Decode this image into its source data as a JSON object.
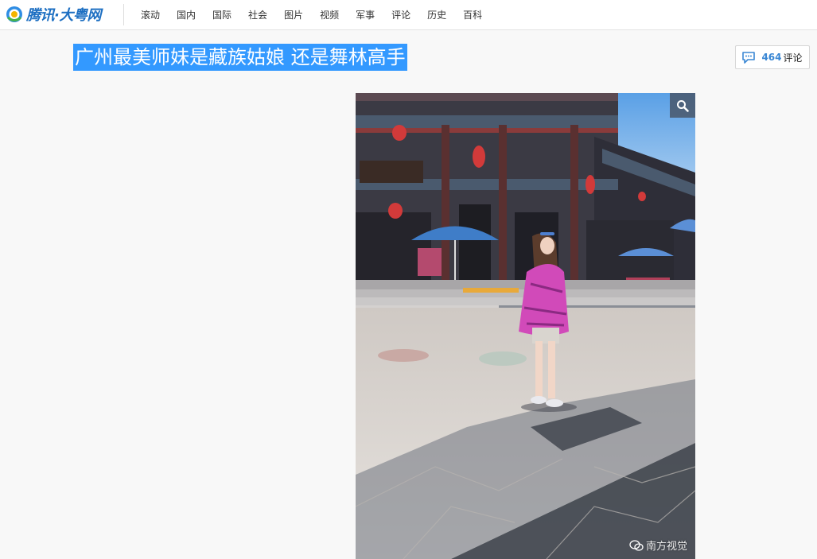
{
  "header": {
    "logo_text": "腾讯·大粤网",
    "nav": [
      "滚动",
      "国内",
      "国际",
      "社会",
      "图片",
      "视频",
      "军事",
      "评论",
      "历史",
      "百科"
    ]
  },
  "article": {
    "title": "广州最美师妹是藏族姑娘 还是舞林高手",
    "comments": {
      "count": "464",
      "label": "评论"
    },
    "photo": {
      "watermark": "南方视觉",
      "zoom_icon": "magnifier-icon"
    }
  },
  "colors": {
    "title_highlight": "#3399ff",
    "brand_blue": "#1d6fc2",
    "comment_count": "#3a87d4"
  }
}
